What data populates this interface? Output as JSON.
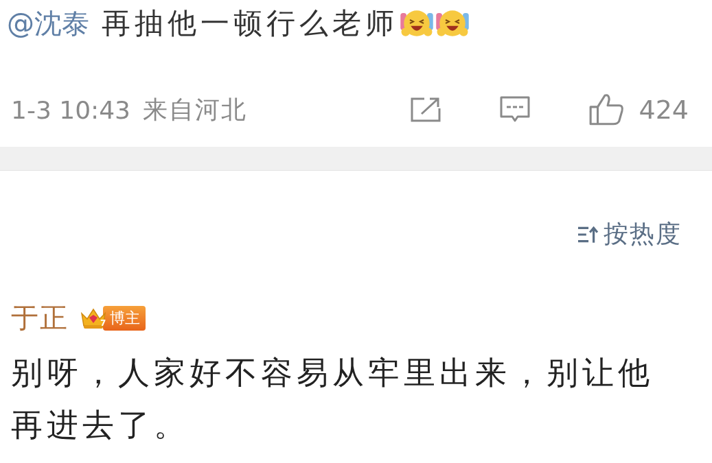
{
  "post": {
    "mention": "@沈泰",
    "text": "再抽他一顿行么老师",
    "emojis": [
      {
        "kind": "laughing"
      },
      {
        "kind": "laughing"
      }
    ],
    "time": "1-3 10:43",
    "location": "来自河北",
    "likes": "424"
  },
  "sort": {
    "label": "按热度"
  },
  "comment": {
    "author": "于正",
    "badge_level": "7",
    "badge": "博主",
    "text": "别呀，人家好不容易从牢里出来，别让他再进去了。"
  }
}
